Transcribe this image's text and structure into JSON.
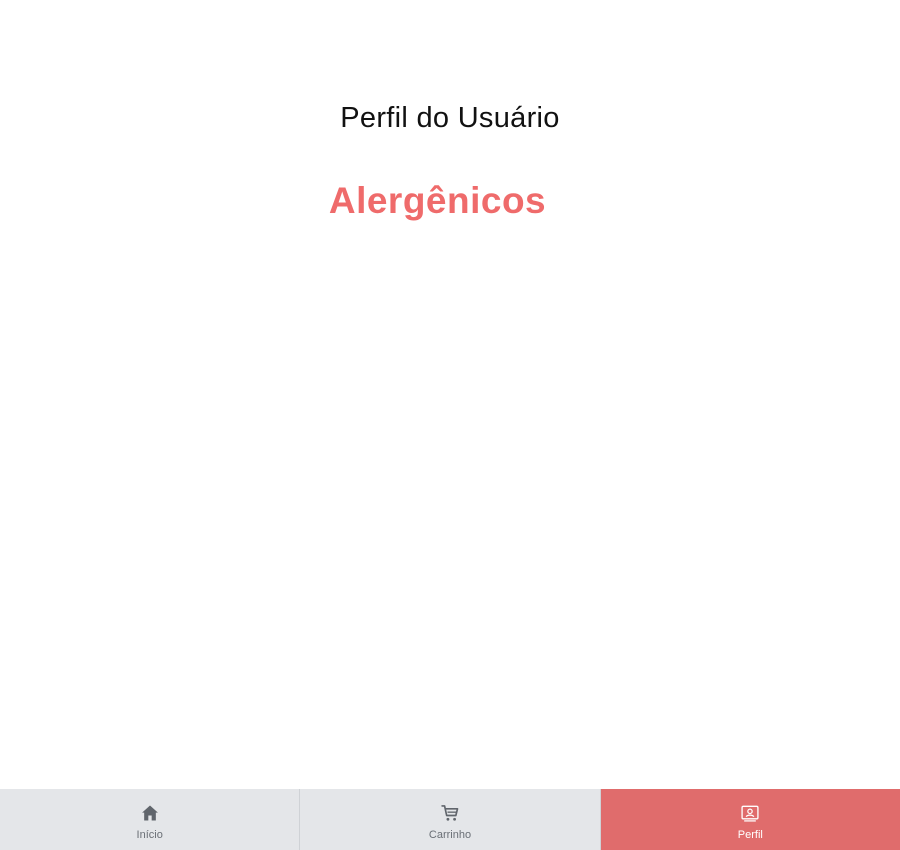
{
  "header": {
    "title": "Perfil do Usuário"
  },
  "section": {
    "title": "Alergênicos"
  },
  "bottom_nav": {
    "items": [
      {
        "label": "Início",
        "icon": "home-icon",
        "active": false
      },
      {
        "label": "Carrinho",
        "icon": "cart-icon",
        "active": false
      },
      {
        "label": "Perfil",
        "icon": "profile-icon",
        "active": true
      }
    ]
  },
  "colors": {
    "accent": "#ef6b6b",
    "nav_active": "#e06c6c",
    "nav_background": "#e4e6e9",
    "nav_label": "#6a6f76"
  }
}
